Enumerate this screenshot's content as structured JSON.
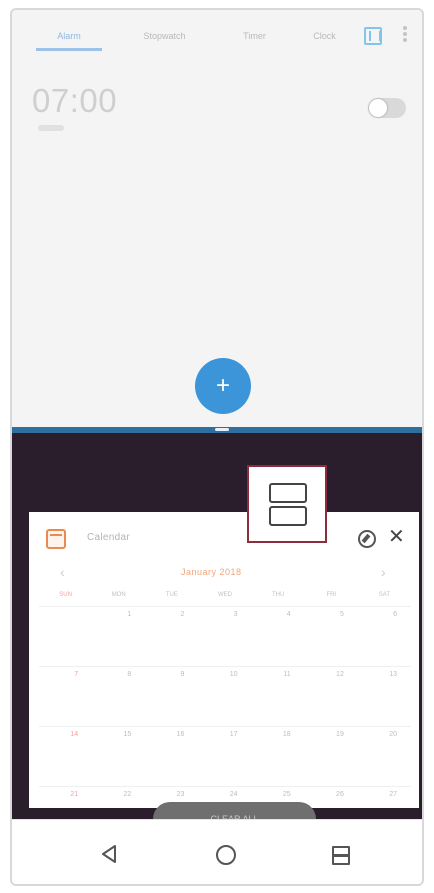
{
  "top_app": {
    "tabs": [
      {
        "label": "Alarm",
        "active": true
      },
      {
        "label": "Stopwatch",
        "active": false
      },
      {
        "label": "Timer",
        "active": false
      },
      {
        "label": "Clock",
        "active": false
      }
    ],
    "alarm": {
      "time": "07:00",
      "enabled": false
    },
    "fab_label": "+"
  },
  "recent_card": {
    "app_name": "Calendar",
    "month": "January 2018",
    "prev": "‹",
    "next": "›",
    "days_of_week": [
      "SUN",
      "MON",
      "TUE",
      "WED",
      "THU",
      "FRI",
      "SAT"
    ],
    "weeks": [
      [
        "",
        "1",
        "2",
        "3",
        "4",
        "5",
        "6"
      ],
      [
        "7",
        "8",
        "9",
        "10",
        "11",
        "12",
        "13"
      ],
      [
        "14",
        "15",
        "16",
        "17",
        "18",
        "19",
        "20"
      ],
      [
        "21",
        "22",
        "23",
        "24",
        "25",
        "26",
        "27"
      ]
    ],
    "close": "✕"
  },
  "pill_label": "CLEAR ALL",
  "icons": {
    "split_icon": "split-screen-icon",
    "back": "back-icon",
    "home": "home-icon",
    "recents": "recents-icon"
  },
  "nav": {
    "back": "◁"
  }
}
